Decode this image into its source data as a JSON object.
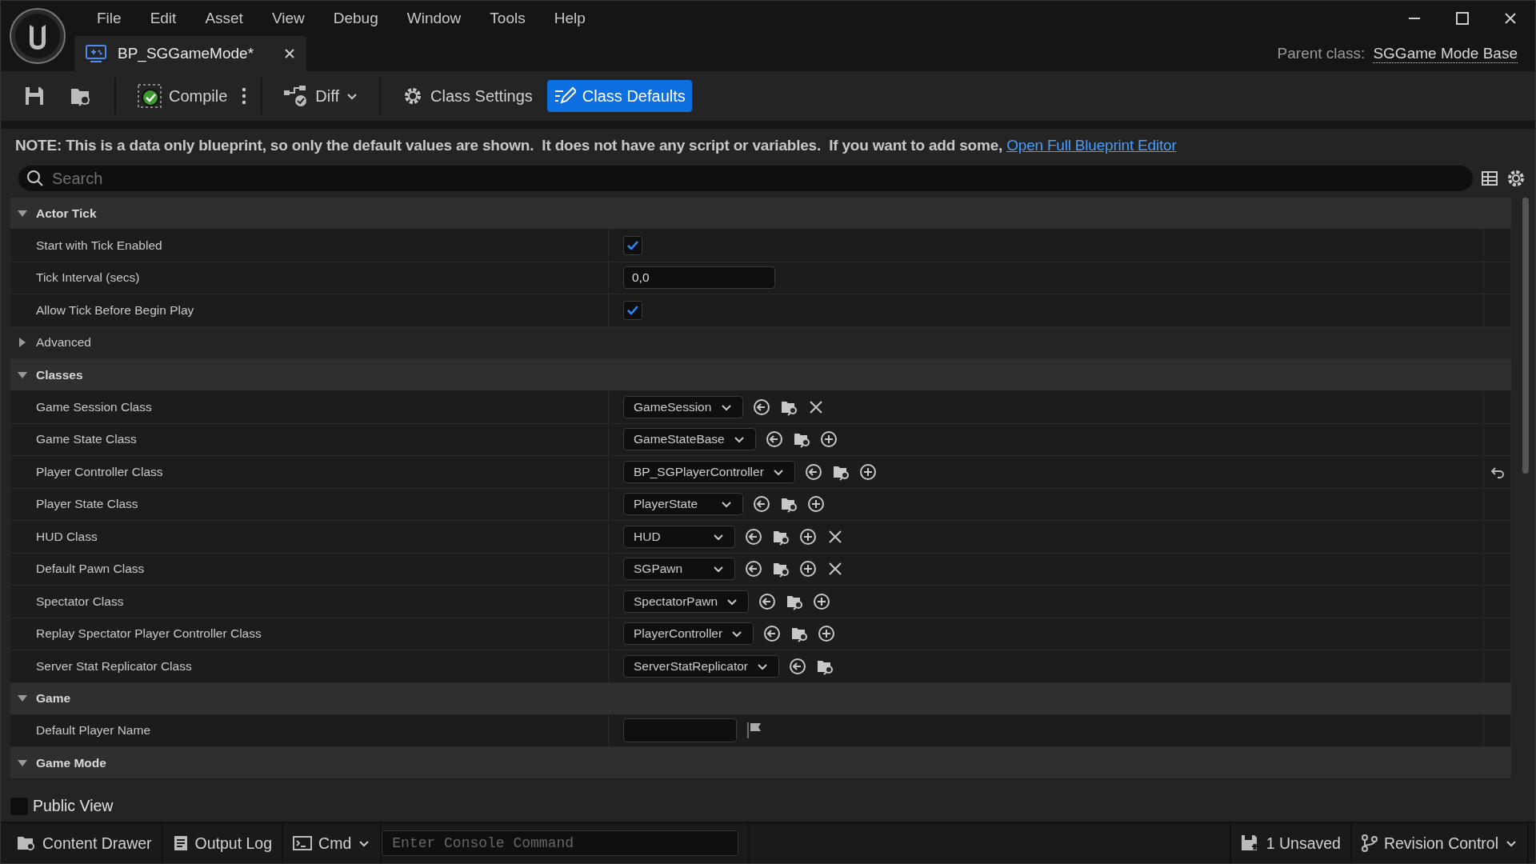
{
  "menu": [
    "File",
    "Edit",
    "Asset",
    "View",
    "Debug",
    "Window",
    "Tools",
    "Help"
  ],
  "document_tab": {
    "title": "BP_SGGameMode*"
  },
  "parent_class": {
    "label": "Parent class:",
    "value": "SGGame Mode Base"
  },
  "toolbar": {
    "compile": "Compile",
    "diff": "Diff",
    "modes": [
      {
        "label": "Class Settings",
        "selected": false
      },
      {
        "label": "Class Defaults",
        "selected": true
      }
    ]
  },
  "note": {
    "text": "NOTE: This is a data only blueprint, so only the default values are shown.  It does not have any script or variables.  If you want to add some,",
    "link": "Open Full Blueprint Editor"
  },
  "search": {
    "placeholder": "Search"
  },
  "sections": [
    {
      "title": "Actor Tick",
      "expanded": true,
      "rows": [
        {
          "kind": "checkbox",
          "label": "Start with Tick Enabled",
          "checked": true
        },
        {
          "kind": "number",
          "label": "Tick Interval (secs)",
          "value": "0,0"
        },
        {
          "kind": "checkbox",
          "label": "Allow Tick Before Begin Play",
          "checked": true
        },
        {
          "kind": "group",
          "label": "Advanced",
          "expanded": false
        }
      ]
    },
    {
      "title": "Classes",
      "expanded": true,
      "rows": [
        {
          "kind": "class",
          "label": "Game Session Class",
          "value": "GameSession",
          "actions": [
            {
              "kind": "use"
            },
            {
              "kind": "browse"
            },
            {
              "kind": "clear"
            }
          ]
        },
        {
          "kind": "class",
          "label": "Game State Class",
          "value": "GameStateBase",
          "actions": [
            {
              "kind": "use"
            },
            {
              "kind": "browse"
            },
            {
              "kind": "new"
            }
          ]
        },
        {
          "kind": "class",
          "label": "Player Controller Class",
          "value": "BP_SGPlayerController",
          "actions": [
            {
              "kind": "use"
            },
            {
              "kind": "browse"
            },
            {
              "kind": "new"
            }
          ],
          "modified": true
        },
        {
          "kind": "class",
          "label": "Player State Class",
          "value": "PlayerState",
          "actions": [
            {
              "kind": "use"
            },
            {
              "kind": "browse"
            },
            {
              "kind": "new"
            }
          ]
        },
        {
          "kind": "class",
          "label": "HUD Class",
          "value": "HUD",
          "actions": [
            {
              "kind": "use"
            },
            {
              "kind": "browse"
            },
            {
              "kind": "new"
            },
            {
              "kind": "clear"
            }
          ]
        },
        {
          "kind": "class",
          "label": "Default Pawn Class",
          "value": "SGPawn",
          "actions": [
            {
              "kind": "use"
            },
            {
              "kind": "browse"
            },
            {
              "kind": "new"
            },
            {
              "kind": "clear"
            }
          ]
        },
        {
          "kind": "class",
          "label": "Spectator Class",
          "value": "SpectatorPawn",
          "actions": [
            {
              "kind": "use"
            },
            {
              "kind": "browse"
            },
            {
              "kind": "new"
            }
          ]
        },
        {
          "kind": "class",
          "label": "Replay Spectator Player Controller Class",
          "value": "PlayerController",
          "actions": [
            {
              "kind": "use"
            },
            {
              "kind": "browse"
            },
            {
              "kind": "new"
            }
          ]
        },
        {
          "kind": "class",
          "label": "Server Stat Replicator Class",
          "value": "ServerStatReplicator",
          "actions": [
            {
              "kind": "use"
            },
            {
              "kind": "browse"
            }
          ]
        }
      ]
    },
    {
      "title": "Game",
      "expanded": true,
      "rows": [
        {
          "kind": "text",
          "label": "Default Player Name"
        }
      ]
    },
    {
      "title": "Game Mode",
      "expanded": true
    }
  ],
  "public_view": {
    "label": "Public View",
    "checked": false
  },
  "status_bar": {
    "content_drawer": "Content Drawer",
    "output_log": "Output Log",
    "cmd": "Cmd",
    "console_placeholder": "Enter Console Command",
    "unsaved": "1 Unsaved",
    "revision_control": "Revision Control"
  }
}
